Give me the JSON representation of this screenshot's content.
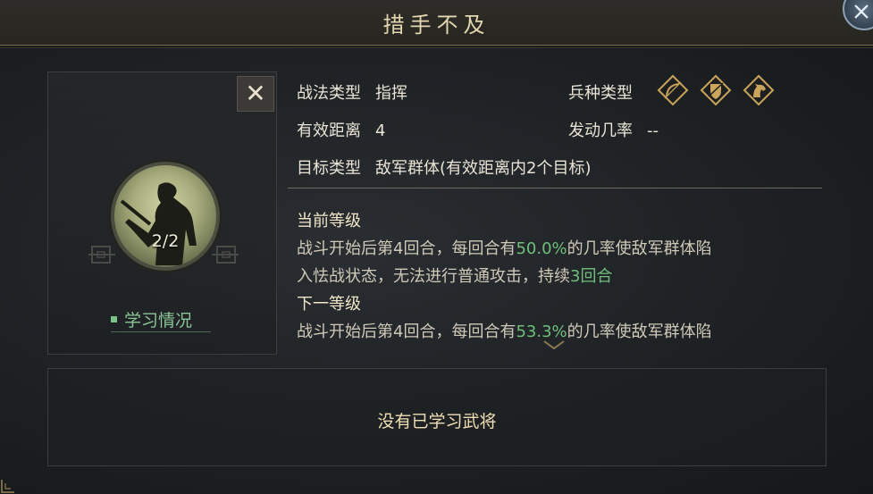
{
  "title": "措手不及",
  "left": {
    "level": "2/2",
    "study_label": "学习情况"
  },
  "info": {
    "tactic_type_label": "战法类型",
    "tactic_type_value": "指挥",
    "range_label": "有效距离",
    "range_value": "4",
    "target_label": "目标类型",
    "target_value": "敌军群体(有效距离内2个目标)",
    "troop_type_label": "兵种类型",
    "trigger_rate_label": "发动几率",
    "trigger_rate_value": "--",
    "troop_icons": [
      "bow-icon",
      "shield-icon",
      "horse-icon"
    ]
  },
  "description": {
    "current_heading": "当前等级",
    "current_line1_pre": "战斗开始后第4回合，每回合有",
    "current_rate": "50.0%",
    "current_line1_post": "的几率使敌军群体陷",
    "current_line2_pre": "入怯战状态，无法进行普通攻击，持续",
    "current_duration": "3回合",
    "next_heading": "下一等级",
    "next_line1_pre": "战斗开始后第4回合，每回合有",
    "next_rate": "53.3%",
    "next_line1_post": "的几率使敌军群体陷"
  },
  "bottom": {
    "empty_text": "没有已学习武将"
  },
  "colors": {
    "highlight": "#6fbf7b",
    "title": "#e3d6b0",
    "accent_gold": "#c9a45a"
  }
}
